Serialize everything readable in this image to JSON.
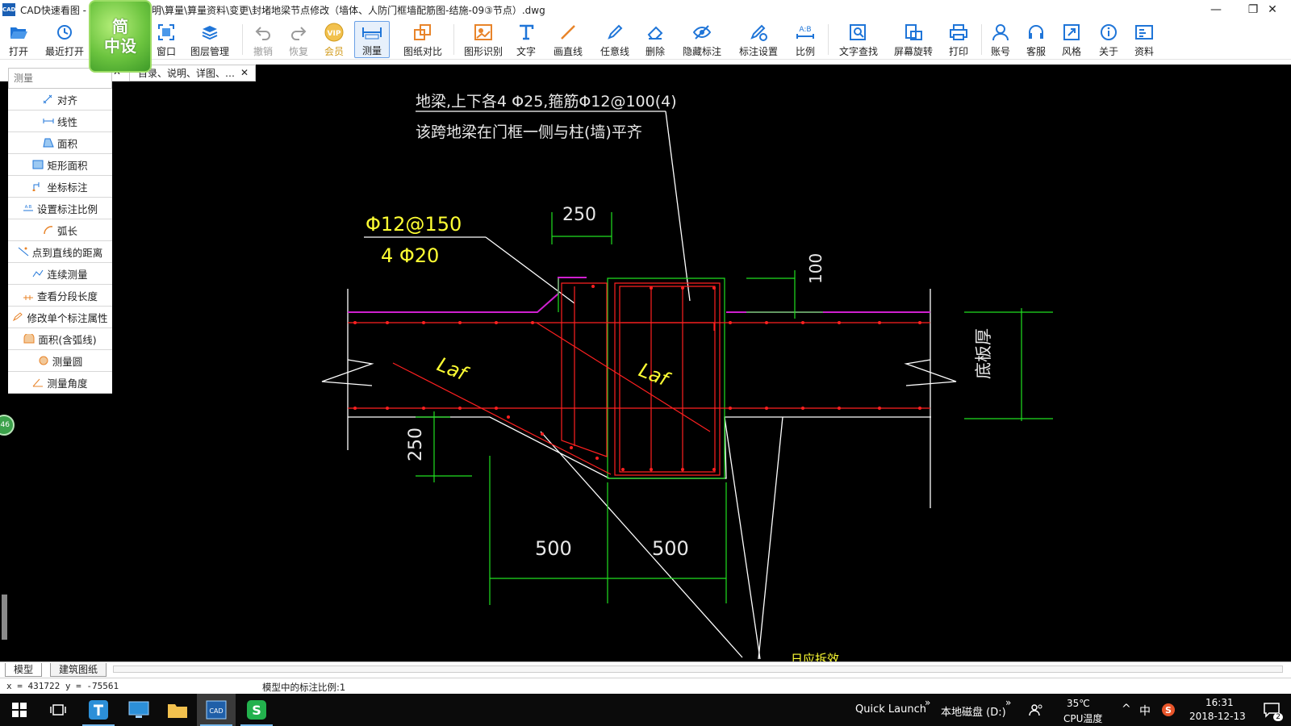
{
  "window": {
    "title_app": "CAD快速看图 -",
    "title_path": "明\\算量\\算量资料\\变更\\封堵地梁节点修改（墙体、人防门框墙配筋图-结施-09③节点）.dwg",
    "minimize": "—",
    "maximize": "❐",
    "close": "✕"
  },
  "logo": {
    "line1": "简",
    "line2": "中设"
  },
  "toolbar": {
    "open": "打开",
    "recent": "最近打开",
    "window": "窗口",
    "layers": "图层管理",
    "undo": "撤销",
    "redo": "恢复",
    "vip": "会员",
    "measure": "测量",
    "compare": "图纸对比",
    "recognize": "图形识别",
    "text": "文字",
    "line": "画直线",
    "freeline": "任意线",
    "delete": "删除",
    "hide_dim": "隐藏标注",
    "dim_settings": "标注设置",
    "scale": "比例",
    "text_search": "文字查找",
    "rotate": "屏幕旋转",
    "print": "打印",
    "account": "账号",
    "service": "客服",
    "style": "风格",
    "about": "关于",
    "resources": "资料"
  },
  "doc_tab": {
    "label": "目录、说明、详图、…",
    "close": "✕"
  },
  "panel": {
    "placeholder": "测量",
    "close": "✕",
    "items": [
      {
        "label": "对齐",
        "icon": "align-dim-icon"
      },
      {
        "label": "线性",
        "icon": "linear-dim-icon"
      },
      {
        "label": "面积",
        "icon": "area-icon"
      },
      {
        "label": "矩形面积",
        "icon": "rect-area-icon"
      },
      {
        "label": "坐标标注",
        "icon": "coordinate-icon"
      },
      {
        "label": "设置标注比例",
        "icon": "dim-scale-icon"
      },
      {
        "label": "弧长",
        "icon": "arc-length-icon"
      },
      {
        "label": "点到直线的距离",
        "icon": "point-line-icon"
      },
      {
        "label": "连续测量",
        "icon": "continuous-icon"
      },
      {
        "label": "查看分段长度",
        "icon": "segment-icon"
      },
      {
        "label": "修改单个标注属性",
        "icon": "edit-dim-icon"
      },
      {
        "label": "面积(含弧线)",
        "icon": "arc-area-icon"
      },
      {
        "label": "测量圆",
        "icon": "circle-icon"
      },
      {
        "label": "测量角度",
        "icon": "angle-icon"
      }
    ]
  },
  "badge": "46",
  "drawing": {
    "note1": "地梁,上下各4 Φ25,箍筋Φ12@100(4)",
    "note2": "该跨地梁在门框一侧与柱(墙)平齐",
    "rebar1": "Φ12@150",
    "rebar2": "4 Φ20",
    "dim_250_top": "250",
    "dim_100": "100",
    "dim_250_left": "250",
    "dim_500_a": "500",
    "dim_500_b": "500",
    "laf_a": "Laf",
    "laf_b": "Laf",
    "slab": "底板厚",
    "bottom_text": "日应拆效"
  },
  "layout_tabs": {
    "model": "模型",
    "arch": "建筑图纸"
  },
  "status": {
    "coords": "x = 431722  y = -75561",
    "scale": "模型中的标注比例:1"
  },
  "taskbar": {
    "quick_launch": "Quick Launch",
    "disk": "本地磁盘 (D:)",
    "temp": "35℃",
    "cpu": "CPU温度",
    "ime": "中",
    "time": "16:31",
    "date": "2018-12-13",
    "notify": "2"
  },
  "colors": {
    "canvas": "#000000",
    "concrete": "#ffffff",
    "rebar": "#ff2020",
    "dimension": "#20e020",
    "annotation": "#ffff33",
    "magenta": "#d020d0",
    "accent": "#1f75d8"
  }
}
